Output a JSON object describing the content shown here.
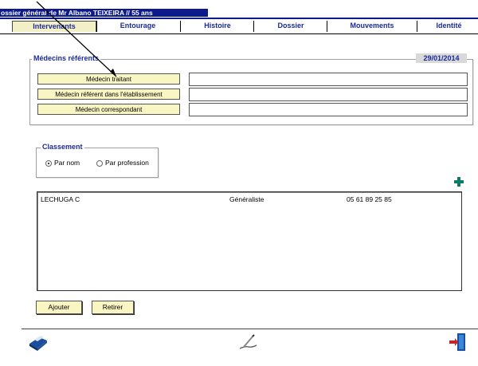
{
  "window": {
    "title": "ossier général de Mr Albano TEIXEIRA  // 55 ans"
  },
  "tabs": [
    {
      "label": "Intervenants",
      "active": true
    },
    {
      "label": "Entourage",
      "active": false
    },
    {
      "label": "Histoire",
      "active": false
    },
    {
      "label": "Dossier",
      "active": false
    },
    {
      "label": "Mouvements",
      "active": false
    },
    {
      "label": "Identité",
      "active": false
    }
  ],
  "medecins": {
    "group_title": "Médecins référents",
    "date": "29/01/2014",
    "rows": [
      {
        "label": "Médecin traitant",
        "value": ""
      },
      {
        "label": "Médecin référent dans l'établissement",
        "value": ""
      },
      {
        "label": "Médecin correspondant",
        "value": ""
      }
    ]
  },
  "classement": {
    "group_title": "Classement",
    "options": [
      {
        "label": "Par nom",
        "checked": true
      },
      {
        "label": "Par profession",
        "checked": false
      }
    ]
  },
  "list": {
    "rows": [
      {
        "name": "LECHUGA C",
        "profession": "Généraliste",
        "phone": "05 61 89 25 85"
      }
    ]
  },
  "buttons": {
    "add": "Ajouter",
    "remove": "Retirer"
  },
  "icons": {
    "add_icon": "plus-icon",
    "printer": "printer-icon",
    "sign": "signature-icon",
    "exit": "exit-door-icon",
    "accent_color": "#1b2a9a",
    "yellow_button": "#faf6c4"
  }
}
